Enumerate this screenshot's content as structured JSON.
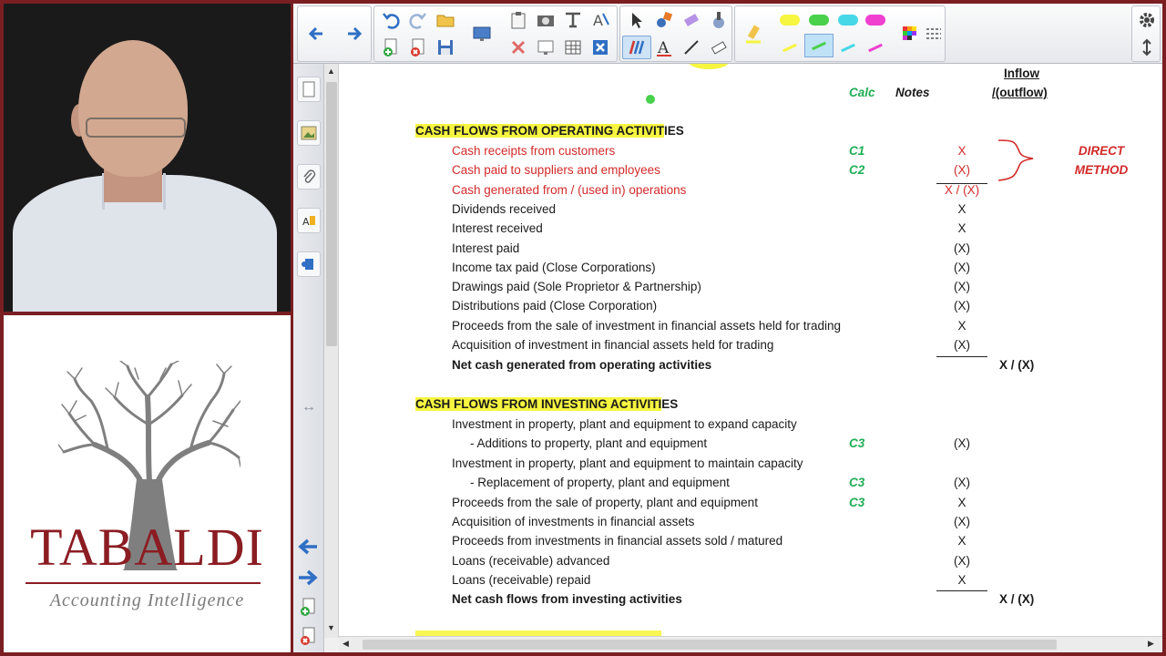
{
  "logo": {
    "brand": "TABALDI",
    "tagline": "Accounting Intelligence"
  },
  "toolbar": {
    "icons": [
      "back-arrow-icon",
      "forward-arrow-icon",
      "undo-icon",
      "redo-icon",
      "open-icon",
      "add-page-icon",
      "delete-page-icon",
      "save-icon",
      "screen-capture-icon",
      "clear-icon",
      "screen-shade-icon",
      "table-icon",
      "document-camera-icon",
      "pointer-icon",
      "fill-icon",
      "eraser-tool-icon",
      "magic-pen-icon",
      "pen-icon",
      "text-icon",
      "line-icon",
      "eraser-icon",
      "highlighter-icon",
      "settings-icon",
      "updown-icon"
    ],
    "highlighter_colors": [
      "#f6f540",
      "#49d14b",
      "#46d8e6",
      "#f040d0"
    ],
    "accent": "#2f6fc4"
  },
  "document": {
    "header": {
      "calc": "Calc",
      "notes": "Notes",
      "inflow_line1": "Inflow",
      "inflow_line2": "/(outflow)"
    },
    "operating": {
      "title_hl": "CASH FLOWS FROM OPERATING ACTIVIT",
      "title_rest": "IES",
      "rows": [
        {
          "label": "Cash receipts from customers",
          "calc": "C1",
          "value": "X"
        },
        {
          "label": "Cash paid to suppliers and employees",
          "calc": "C2",
          "value": "(X)"
        },
        {
          "label": "Cash generated from / (used in) operations",
          "calc": "",
          "value": "X / (X)"
        },
        {
          "label": "Dividends received",
          "calc": "",
          "value": "X"
        },
        {
          "label": "Interest received",
          "calc": "",
          "value": "X"
        },
        {
          "label": "Interest paid",
          "calc": "",
          "value": "(X)"
        },
        {
          "label": "Income tax paid (Close Corporations)",
          "calc": "",
          "value": "(X)"
        },
        {
          "label": "Drawings paid (Sole Proprietor & Partnership)",
          "calc": "",
          "value": "(X)"
        },
        {
          "label": "Distributions paid (Close Corporation)",
          "calc": "",
          "value": "(X)"
        },
        {
          "label": "Proceeds from the sale of investment in financial assets held for trading",
          "calc": "",
          "value": "X"
        },
        {
          "label": "Acquisition of investment in financial assets held for trading",
          "calc": "",
          "value": "(X)"
        }
      ],
      "total_label": "Net cash generated from operating activities",
      "total_value": "X / (X)",
      "annotation_line1": "DIRECT",
      "annotation_line2": "METHOD"
    },
    "investing": {
      "title_hl": "CASH FLOWS FROM INVESTING ACTIVITI",
      "title_rest": "ES",
      "rows": [
        {
          "label": "Investment in property, plant and equipment to expand capacity",
          "calc": "",
          "value": ""
        },
        {
          "label": "- Additions to property, plant  and equipment",
          "calc": "C3",
          "value": "(X)"
        },
        {
          "label": "Investment in property, plant and equipment to maintain capacity",
          "calc": "",
          "value": ""
        },
        {
          "label": "- Replacement of property, plant and equipment",
          "calc": "C3",
          "value": "(X)"
        },
        {
          "label": "Proceeds from the sale of property, plant and equipment",
          "calc": "C3",
          "value": "X"
        },
        {
          "label": "Acquisition of investments in financial assets",
          "calc": "",
          "value": "(X)"
        },
        {
          "label": "Proceeds from investments in financial assets sold / matured",
          "calc": "",
          "value": "X"
        },
        {
          "label": "Loans (receivable) advanced",
          "calc": "",
          "value": "(X)"
        },
        {
          "label": "Loans (receivable) repaid",
          "calc": "",
          "value": "X"
        }
      ],
      "total_label": "Net cash flows from investing activities",
      "total_value": "X / (X)"
    }
  }
}
